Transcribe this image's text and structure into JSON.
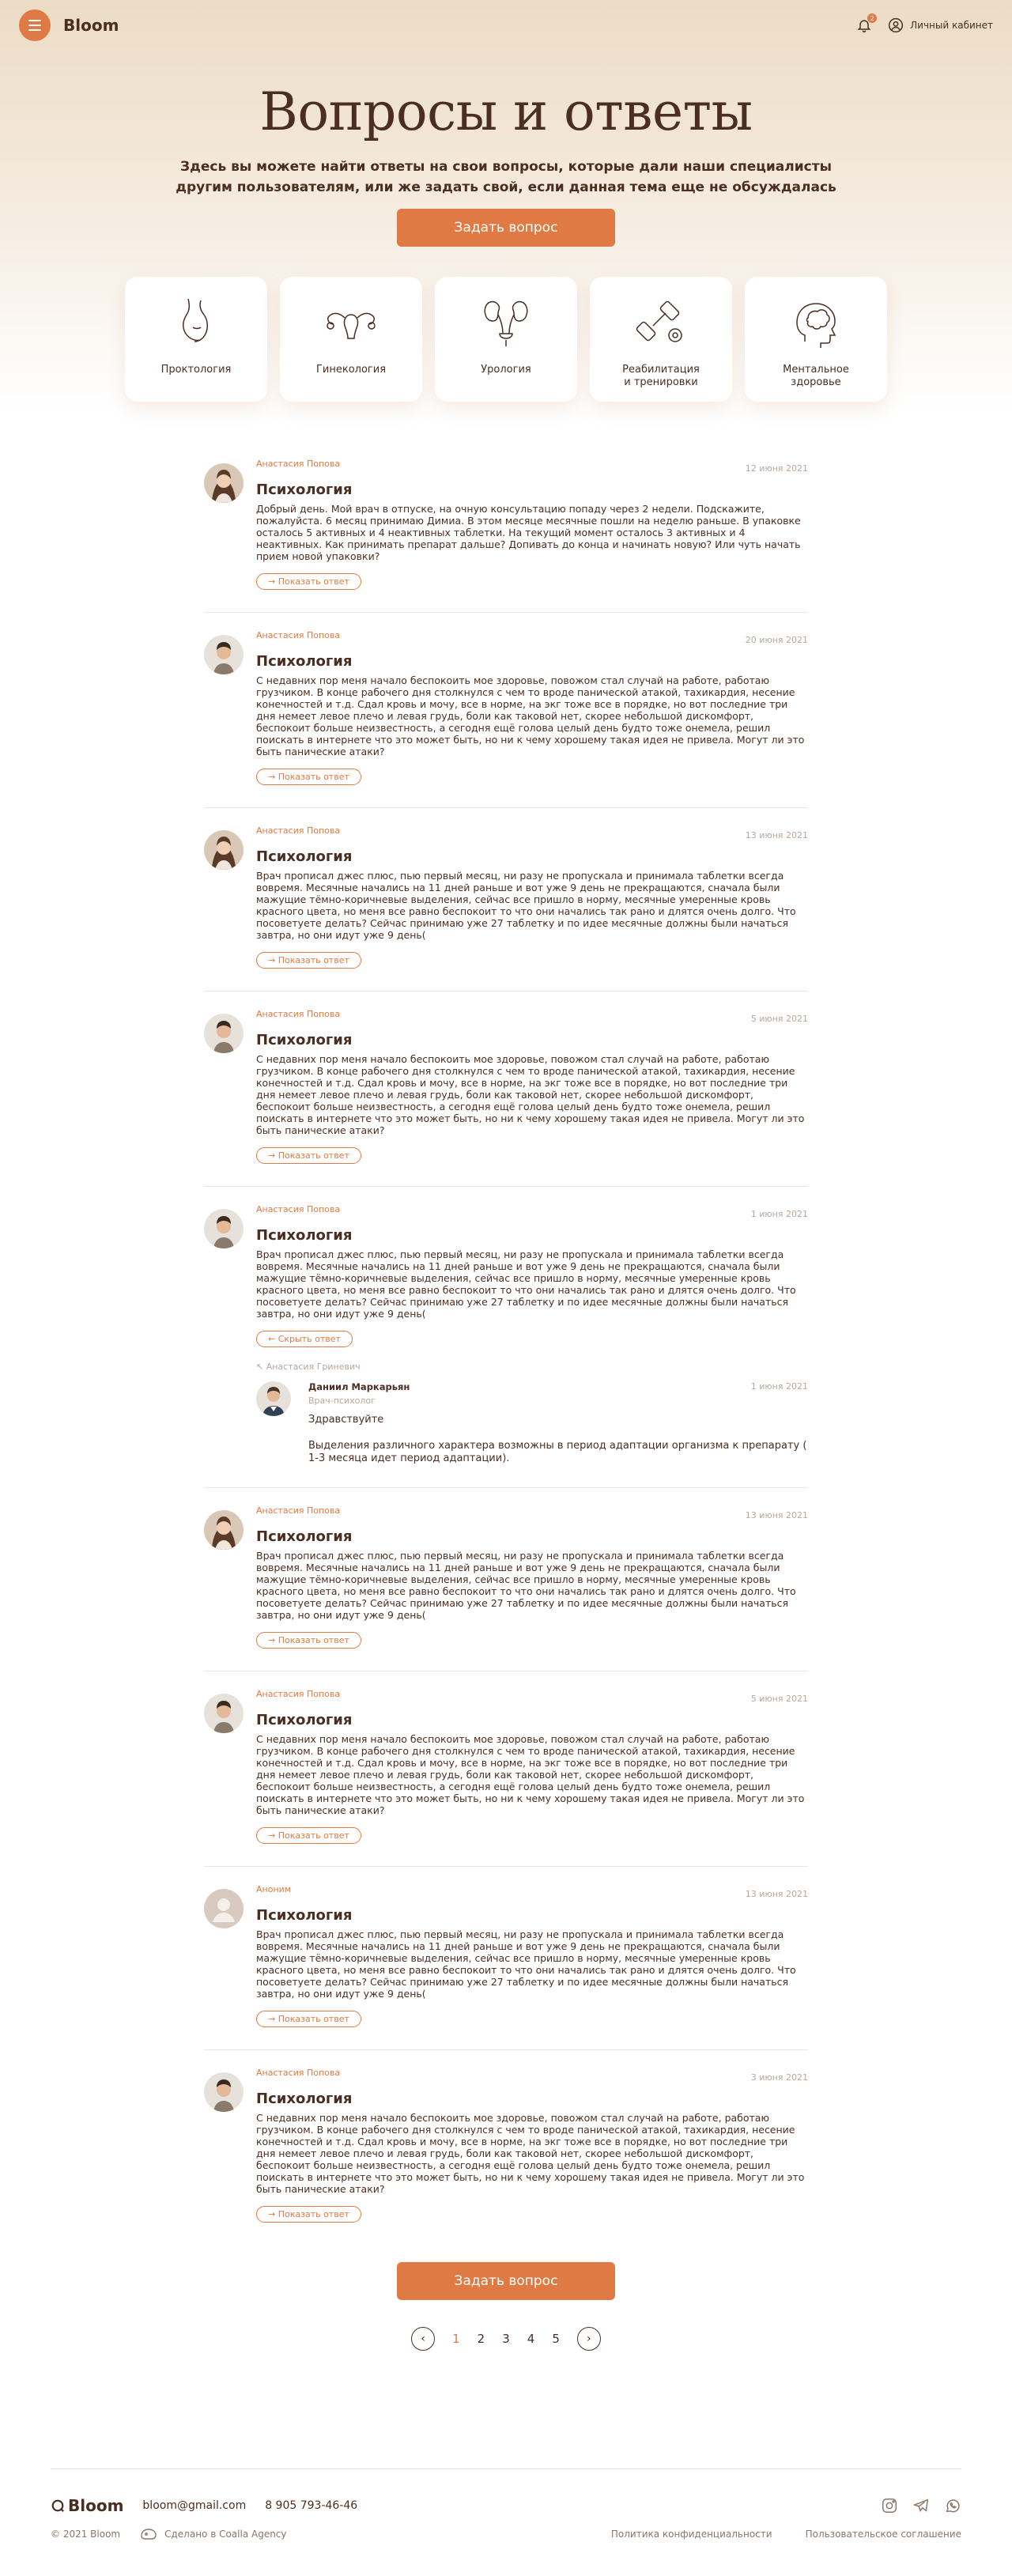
{
  "header": {
    "brand": "Bloom",
    "notif_count": "2",
    "account_label": "Личный кабинет"
  },
  "hero": {
    "title": "Вопросы и ответы",
    "subtitle_line1": "Здесь вы можете найти ответы на свои вопросы, которые дали наши специалисты",
    "subtitle_line2": "другим пользователям, или же задать свой, если данная тема еще не обсуждалась",
    "ask_button": "Задать вопрос"
  },
  "categories": [
    {
      "label": "Проктология",
      "icon": "proctology-icon"
    },
    {
      "label": "Гинекология",
      "icon": "gynecology-icon"
    },
    {
      "label": "Урология",
      "icon": "urology-icon"
    },
    {
      "label": "Реабилитация\nи тренировки",
      "icon": "dumbbell-icon"
    },
    {
      "label": "Ментальное\nздоровье",
      "icon": "brain-head-icon"
    }
  ],
  "questions": [
    {
      "author": "Анастасия Попова",
      "date": "12 июня 2021",
      "title": "Психология",
      "text": "Добрый день. Мой врач в отпуске, на очную консультацию попаду через 2 недели. Подскажите, пожалуйста. 6 месяц принимаю Димиа. В этом месяце месячные пошли на неделю раньше. В упаковке осталось 5 активных и 4 неактивных таблетки. На текущий момент осталось 3 активных и 4 неактивных. Как принимать препарат дальше? Допивать до конца и начинать новую? Или чуть начать прием новой упаковки?",
      "button": "→ Показать ответ",
      "avatar": "woman"
    },
    {
      "author": "Анастасия Попова",
      "date": "20 июня 2021",
      "title": "Психология",
      "text": "С недавних пор меня начало беспокоить мое здоровье, повожом стал случай на работе, работаю грузчиком. В конце рабочего дня столкнулся с чем то вроде панической атакой, тахикардия, несение конечностей и т.д. Сдал кровь и мочу, все в норме, на экг тоже все в порядке, но вот последние три дня немеет левое плечо и левая грудь, боли как таковой нет, скорее небольшой дискомфорт, беспокоит больше неизвестность, а сегодня ещё голова целый день будто тоже онемела, решил поискать в интернете что это может быть, но ни к чему хорошему такая идея не привела. Могут ли это быть панические атаки?",
      "button": "→ Показать ответ",
      "avatar": "man"
    },
    {
      "author": "Анастасия Попова",
      "date": "13 июня 2021",
      "title": "Психология",
      "text": "Врач прописал джес плюс, пью первый месяц, ни разу не пропускала и принимала таблетки всегда вовремя. Месячные начались на 11 дней раньше и вот уже 9 день не прекращаются, сначала были мажущие тёмно-коричневые выделения, сейчас все пришло в норму, месячные умеренные кровь красного цвета, но меня все равно беспокоит то что они начались так рано и длятся очень долго. Что посоветуете делать? Сейчас принимаю уже 27 таблетку и по идее месячные должны были начаться завтра, но они идут уже 9 день(",
      "button": "→ Показать ответ",
      "avatar": "woman"
    },
    {
      "author": "Анастасия Попова",
      "date": "5 июня 2021",
      "title": "Психология",
      "text": "С недавних пор меня начало беспокоить мое здоровье, повожом стал случай на работе, работаю грузчиком. В конце рабочего дня столкнулся с чем то вроде панической атакой, тахикардия, несение конечностей и т.д. Сдал кровь и мочу, все в норме, на экг тоже все в порядке, но вот последние три дня немеет левое плечо и левая грудь, боли как таковой нет, скорее небольшой дискомфорт, беспокоит больше неизвестность, а сегодня ещё голова целый день будто тоже онемела, решил поискать в интернете что это может быть, но ни к чему хорошему такая идея не привела. Могут ли это быть панические атаки?",
      "button": "→ Показать ответ",
      "avatar": "man"
    },
    {
      "author": "Анастасия Попова",
      "date": "1 июня 2021",
      "title": "Психология",
      "text": "Врач прописал джес плюс, пью первый месяц, ни разу не пропускала и принимала таблетки всегда вовремя. Месячные начались на 11 дней раньше и вот уже 9 день не прекращаются, сначала были мажущие тёмно-коричневые выделения, сейчас все пришло в норму, месячные умеренные кровь красного цвета, но меня все равно беспокоит то что они начались так рано и длятся очень долго. Что посоветуете делать? Сейчас принимаю уже 27 таблетку и по идее месячные должны были начаться завтра, но они идут уже 9 день(",
      "button": "← Скрыть ответ",
      "avatar": "man",
      "reply": {
        "to": "↖ Анастасия Гриневич",
        "name": "Даниил Маркарьян",
        "role": "Врач-психолог",
        "date": "1 июня 2021",
        "greeting": "Здравствуйте",
        "text": "Выделения различного характера возможны в период адаптации организма к препарату ( 1-3 месяца идет период адаптации)."
      }
    },
    {
      "author": "Анастасия Попова",
      "date": "13 июня 2021",
      "title": "Психология",
      "text": "Врач прописал джес плюс, пью первый месяц, ни разу не пропускала и принимала таблетки всегда вовремя. Месячные начались на 11 дней раньше и вот уже 9 день не прекращаются, сначала были мажущие тёмно-коричневые выделения, сейчас все пришло в норму, месячные умеренные кровь красного цвета, но меня все равно беспокоит то что они начались так рано и длятся очень долго. Что посоветуете делать? Сейчас принимаю уже 27 таблетку и по идее месячные должны были начаться завтра, но они идут уже 9 день(",
      "button": "→ Показать ответ",
      "avatar": "woman"
    },
    {
      "author": "Анастасия Попова",
      "date": "5 июня 2021",
      "title": "Психология",
      "text": "С недавних пор меня начало беспокоить мое здоровье, повожом стал случай на работе, работаю грузчиком. В конце рабочего дня столкнулся с чем то вроде панической атакой, тахикардия, несение конечностей и т.д. Сдал кровь и мочу, все в норме, на экг тоже все в порядке, но вот последние три дня немеет левое плечо и левая грудь, боли как таковой нет, скорее небольшой дискомфорт, беспокоит больше неизвестность, а сегодня ещё голова целый день будто тоже онемела, решил поискать в интернете что это может быть, но ни к чему хорошему такая идея не привела. Могут ли это быть панические атаки?",
      "button": "→ Показать ответ",
      "avatar": "man"
    },
    {
      "author": "Аноним",
      "date": "13 июня 2021",
      "title": "Психология",
      "text": "Врач прописал джес плюс, пью первый месяц, ни разу не пропускала и принимала таблетки всегда вовремя. Месячные начались на 11 дней раньше и вот уже 9 день не прекращаются, сначала были мажущие тёмно-коричневые выделения, сейчас все пришло в норму, месячные умеренные кровь красного цвета, но меня все равно беспокоит то что они начались так рано и длятся очень долго. Что посоветуете делать? Сейчас принимаю уже 27 таблетку и по идее месячные должны были начаться завтра, но они идут уже 9 день(",
      "button": "→ Показать ответ",
      "avatar": "anon"
    },
    {
      "author": "Анастасия Попова",
      "date": "3 июня 2021",
      "title": "Психология",
      "text": "С недавних пор меня начало беспокоить мое здоровье, повожом стал случай на работе, работаю грузчиком. В конце рабочего дня столкнулся с чем то вроде панической атакой, тахикардия, несение конечностей и т.д. Сдал кровь и мочу, все в норме, на экг тоже все в порядке, но вот последние три дня немеет левое плечо и левая грудь, боли как таковой нет, скорее небольшой дискомфорт, беспокоит больше неизвестность, а сегодня ещё голова целый день будто тоже онемела, решил поискать в интернете что это может быть, но ни к чему хорошему такая идея не привела. Могут ли это быть панические атаки?",
      "button": "→ Показать ответ",
      "avatar": "man"
    }
  ],
  "more_button": "Задать вопрос",
  "pagination": {
    "pages": [
      "1",
      "2",
      "3",
      "4",
      "5"
    ],
    "active": "1"
  },
  "footer": {
    "brand": "Bloom",
    "email": "bloom@gmail.com",
    "phone": "8 905 793-46-46",
    "copyright": "© 2021 Bloom",
    "made_by": "Сделано в Coalla Agency",
    "privacy": "Политика конфиденциальности",
    "agreement": "Пользовательское соглашение"
  },
  "colors": {
    "accent": "#e07a45",
    "text": "#4a2e22",
    "muted": "#b8a79a"
  }
}
